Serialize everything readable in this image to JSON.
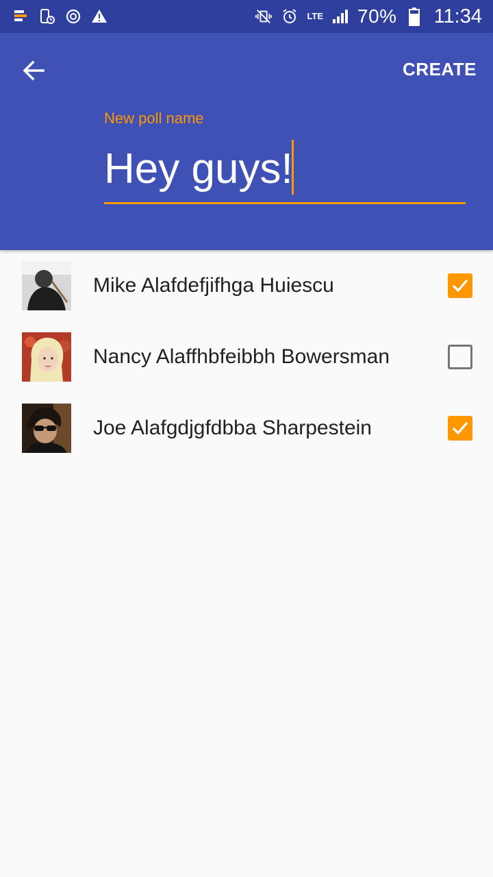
{
  "status_bar": {
    "icons_left": [
      "app-icon",
      "screen-timer-icon",
      "sync-icon",
      "warning-icon"
    ],
    "lte_top": "LTE",
    "battery_percent": "70%",
    "time": "11:34"
  },
  "toolbar": {
    "back_icon": "arrow-left-icon",
    "create_label": "CREATE"
  },
  "poll": {
    "label": "New poll name",
    "value": "Hey guys!"
  },
  "colors": {
    "primary": "#3f51b5",
    "primary_dark": "#2f3f9e",
    "accent": "#ff9800"
  },
  "contacts": [
    {
      "name": "Mike Alafdefjifhga Huiescu",
      "checked": true
    },
    {
      "name": "Nancy Alaffhbfeibbh Bowersman",
      "checked": false
    },
    {
      "name": "Joe Alafgdjgfdbba Sharpestein",
      "checked": true
    }
  ]
}
